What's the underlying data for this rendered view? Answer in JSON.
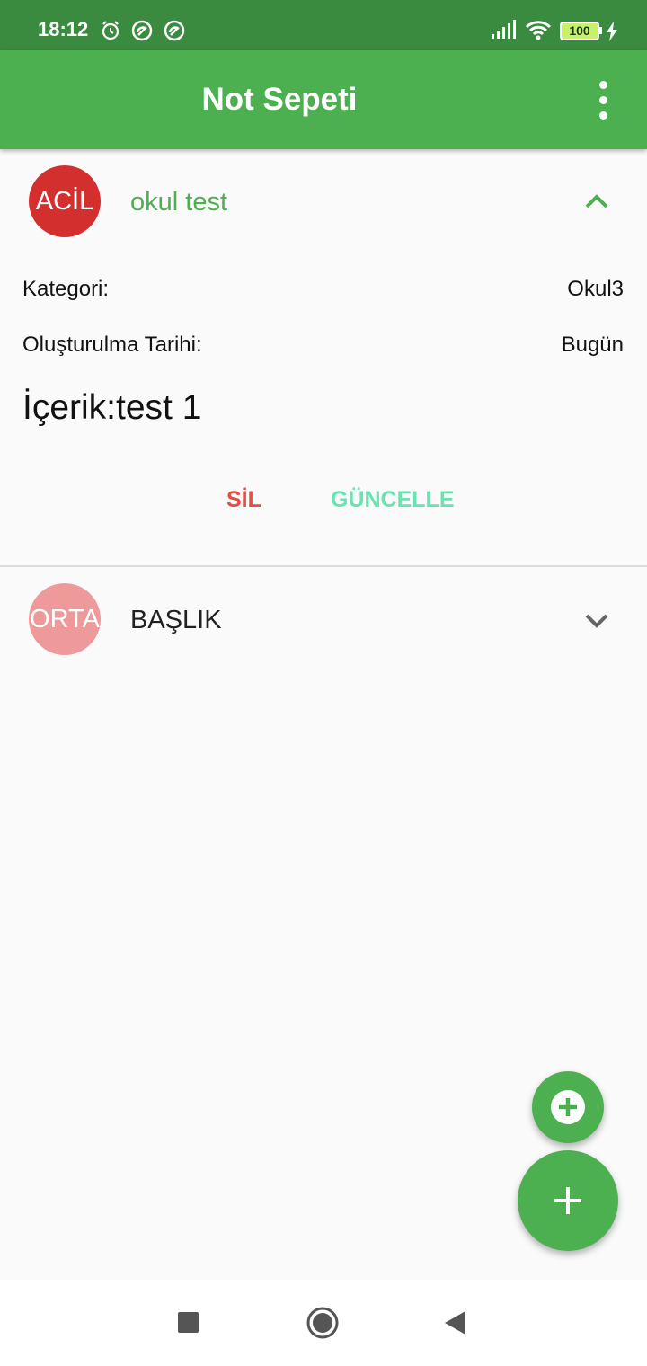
{
  "status_bar": {
    "time": "18:12",
    "battery": "100",
    "icons": [
      "alarm-icon",
      "sync-icon",
      "sync-icon",
      "signal-icon",
      "wifi-icon",
      "battery-icon",
      "charging-icon"
    ]
  },
  "app_bar": {
    "title": "Not Sepeti",
    "menu_icon": "more-vert-icon"
  },
  "notes": [
    {
      "priority": "ACİL",
      "priority_color": "#d32f2f",
      "title": "okul test",
      "title_color": "#4caf50",
      "expanded": true,
      "expand_icon": "chevron-up-icon",
      "category_label": "Kategori:",
      "category_value": "Okul3",
      "date_label": "Oluşturulma Tarihi:",
      "date_value": "Bugün",
      "content": "İçerik:test 1",
      "delete_label": "SİL",
      "update_label": "GÜNCELLE"
    },
    {
      "priority": "ORTA",
      "priority_color": "#ef9a9a",
      "title": "BAŞLIK",
      "title_color": "#212121",
      "expanded": false,
      "expand_icon": "chevron-down-icon"
    }
  ],
  "colors": {
    "status_bar": "#3a8a3f",
    "app_bar": "#4caf50",
    "delete": "#e05046",
    "update": "#69e3b0",
    "fab": "#4caf50"
  },
  "fabs": {
    "small_icon": "add-circle-icon",
    "large_icon": "add-icon"
  },
  "nav_bar": {
    "icons": [
      "recents-square-icon",
      "home-circle-icon",
      "back-triangle-icon"
    ]
  }
}
